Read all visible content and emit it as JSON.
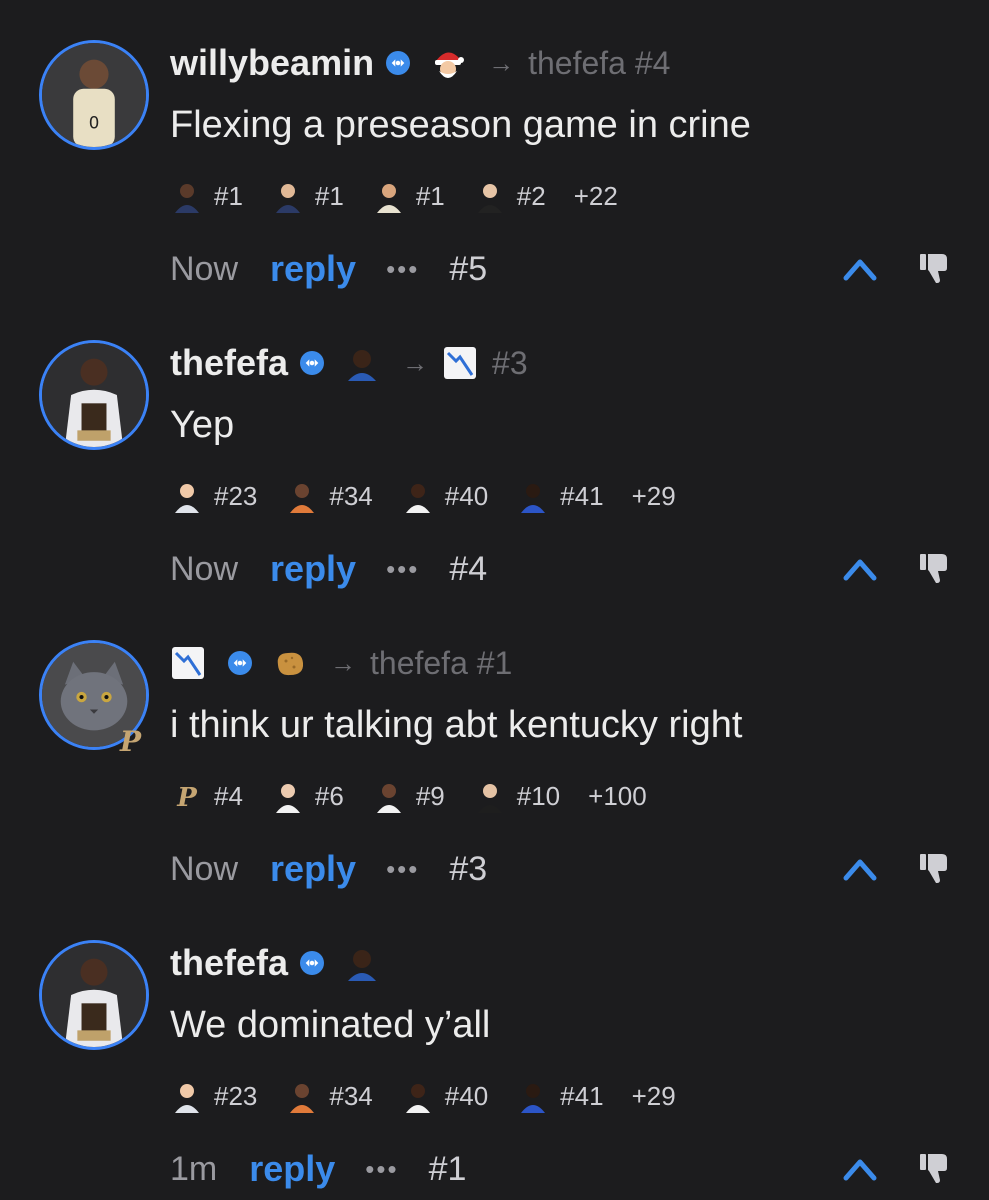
{
  "comments": [
    {
      "username": "willybeamin",
      "reply_to": "thefefa #4",
      "text": "Flexing a preseason game in crine",
      "tags": [
        {
          "label": "#1",
          "icon": "player-face-icon"
        },
        {
          "label": "#1",
          "icon": "player-face-icon"
        },
        {
          "label": "#1",
          "icon": "player-face-icon"
        },
        {
          "label": "#2",
          "icon": "player-face-icon"
        }
      ],
      "more": "+22",
      "time": "Now",
      "reply_label": "reply",
      "dots": "•••",
      "number": "#5"
    },
    {
      "username": "thefefa",
      "reply_to": "#3",
      "text": "Yep",
      "tags": [
        {
          "label": "#23",
          "icon": "player-face-icon"
        },
        {
          "label": "#34",
          "icon": "player-face-icon"
        },
        {
          "label": "#40",
          "icon": "player-face-icon"
        },
        {
          "label": "#41",
          "icon": "player-face-icon"
        }
      ],
      "more": "+29",
      "time": "Now",
      "reply_label": "reply",
      "dots": "•••",
      "number": "#4"
    },
    {
      "username": "",
      "reply_to": "thefefa #1",
      "text": "i think ur talking abt kentucky right",
      "team_badge": "P",
      "tags": [
        {
          "label": "#4",
          "icon": "purdue-logo-icon"
        },
        {
          "label": "#6",
          "icon": "player-face-icon"
        },
        {
          "label": "#9",
          "icon": "player-face-icon"
        },
        {
          "label": "#10",
          "icon": "player-face-icon"
        }
      ],
      "more": "+100",
      "time": "Now",
      "reply_label": "reply",
      "dots": "•••",
      "number": "#3"
    },
    {
      "username": "thefefa",
      "reply_to": "",
      "text": "We dominated y’all",
      "tags": [
        {
          "label": "#23",
          "icon": "player-face-icon"
        },
        {
          "label": "#34",
          "icon": "player-face-icon"
        },
        {
          "label": "#40",
          "icon": "player-face-icon"
        },
        {
          "label": "#41",
          "icon": "player-face-icon"
        }
      ],
      "more": "+29",
      "time": "1m",
      "reply_label": "reply",
      "dots": "•••",
      "number": "#1"
    }
  ],
  "colors": {
    "background": "#1c1c1e",
    "accent": "#3b8beb",
    "muted": "#6e6e73"
  }
}
